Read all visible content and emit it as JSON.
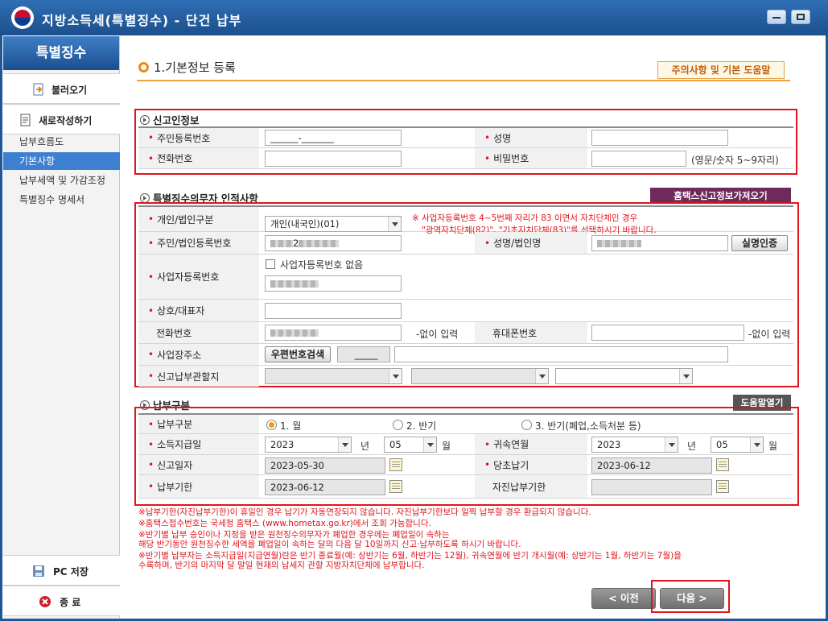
{
  "window": {
    "title": "지방소득세(특별징수) - 단건 납부"
  },
  "sidebar": {
    "title": "특별징수",
    "load_btn": "불러오기",
    "new_btn": "새로작성하기",
    "items": [
      "납부흐름도",
      "기본사항",
      "납부세액 및 가감조정",
      "특별징수 명세서"
    ],
    "active_index": 1,
    "save_btn": "PC 저장",
    "exit_btn": "종 료"
  },
  "page": {
    "heading": "1.기본정보 등록",
    "help_btn": "주의사항 및 기본 도움말"
  },
  "section1": {
    "title": "신고인정보",
    "resident_no_label": "주민등록번호",
    "resident_no_value": "______-_______",
    "name_label": "성명",
    "phone_label": "전화번호",
    "password_label": "비밀번호",
    "password_hint": "(영문/숫자 5~9자리)"
  },
  "section2": {
    "title": "특별징수의무자 인적사항",
    "hometax_btn": "홈택스신고정보가져오기",
    "type_label": "개인/법인구분",
    "type_value": "개인(내국인)(01)",
    "warn1": "※  사업자등록번호 4~5번째 자리가 83 이면서 자치단체인 경우",
    "warn2": "\"광역자치단체(82)\", \"기초자치단체(83)\"를 선택하시기 바랍니다.",
    "regno_label": "주민/법인등록번호",
    "regno_partial": "2",
    "corp_name_label": "성명/법인명",
    "verify_btn": "실명인증",
    "bizno_label": "사업자등록번호",
    "no_bizno_label": "사업자등록번호 없음",
    "rep_label": "상호/대표자",
    "phone_label": "전화번호",
    "phone_hint": "-없이 입력",
    "mobile_label": "휴대폰번호",
    "mobile_hint": "-없이 입력",
    "addr_label": "사업장주소",
    "zip_btn": "우편번호검색",
    "zip_value": "_____",
    "office_label": "신고납부관할지"
  },
  "section3": {
    "title": "납부구분",
    "help_btn": "도움말열기",
    "kind_label": "납부구분",
    "opt1": "1. 월",
    "opt2": "2. 반기",
    "opt3": "3. 반기(폐업,소득처분 등)",
    "pay_month_label": "소득지급일",
    "pay_year": "2023",
    "year_unit": "년",
    "pay_month": "05",
    "month_unit": "월",
    "belong_label": "귀속연월",
    "belong_year": "2023",
    "belong_month": "05",
    "report_date_label": "신고일자",
    "report_date": "2023-05-30",
    "orig_due_label": "당초납기",
    "orig_due": "2023-06-12",
    "due_label": "납부기한",
    "due_date": "2023-06-12",
    "self_due_label": "자진납부기한"
  },
  "notes": [
    "※납부기한(자진납부기한)이 휴일인 경우 납기가 자동연장되지 않습니다. 자진납부기한보다 일찍 납부할 경우 환급되지 않습니다.",
    "※홈택스접수번호는 국세청 홈택스 (www.hometax.go.kr)에서 조회 가능합니다.",
    "※반기별 납부 승인이나 지정을 받은 원천징수의무자가 폐업한 경우에는 폐업일이 속하는",
    "   해당 반기동안 원천징수한 세액을 폐업일이 속하는 달의 다음 달 10일까지 신고·납부하도록 하시기 바랍니다.",
    "※반기별 납부자는 소득지급일(지급연월)란은 반기 종료월(예: 상반기는 6월, 하반기는 12월), 귀속연월에 반기 개시월(예: 상반기는 1월, 하반기는 7월)을",
    "   수록하며, 반기의 마지막 달 말일 현재의 납세지 관할 지방자치단체에 납부합니다."
  ],
  "nav": {
    "prev": "< 이전",
    "next": "다음 >"
  },
  "colors": {
    "title_bar": "#1c4f8d",
    "accent_orange": "#f0a040",
    "highlight_red": "#e0141c",
    "active_blue": "#3d7fd0"
  }
}
